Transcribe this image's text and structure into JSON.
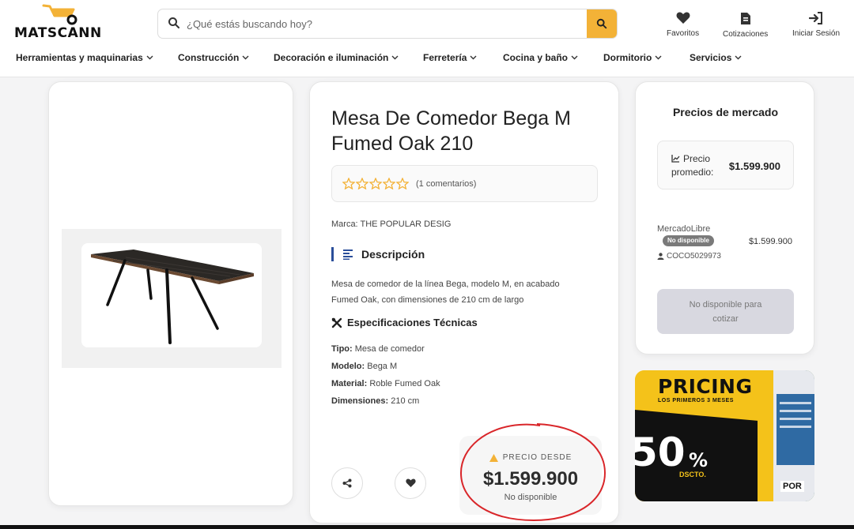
{
  "brand": {
    "name": "MATSCANN"
  },
  "search": {
    "placeholder": "¿Qué estás buscando hoy?"
  },
  "header_actions": [
    {
      "label": "Favoritos",
      "icon": "heart-icon"
    },
    {
      "label": "Cotizaciones",
      "icon": "document-icon"
    },
    {
      "label": "Iniciar Sesión",
      "icon": "login-icon"
    }
  ],
  "nav": [
    "Herramientas y maquinarias",
    "Construcción",
    "Decoración e iluminación",
    "Ferretería",
    "Cocina y baño",
    "Dormitorio",
    "Servicios"
  ],
  "product": {
    "title": "Mesa De Comedor Bega M Fumed Oak 210",
    "rating_stars": 0,
    "rating_max": 5,
    "comments": "(1 comentarios)",
    "brand_line": "Marca: THE POPULAR DESIG",
    "description_heading": "Descripción",
    "description": "Mesa de comedor de la línea Bega, modelo M, en acabado Fumed Oak, con dimensiones de 210 cm de largo",
    "specs_heading": "Especificaciones Técnicas",
    "specs": [
      {
        "label": "Tipo:",
        "value": "Mesa de comedor"
      },
      {
        "label": "Modelo:",
        "value": "Bega M"
      },
      {
        "label": "Material:",
        "value": "Roble Fumed Oak"
      },
      {
        "label": "Dimensiones:",
        "value": "210 cm"
      }
    ],
    "price_label": "PRECIO DESDE",
    "price": "$1.599.900",
    "price_status": "No disponible"
  },
  "market": {
    "title": "Precios de mercado",
    "avg_label_1": "Precio",
    "avg_label_2": "promedio:",
    "avg_value": "$1.599.900",
    "seller": {
      "name": "MercadoLibre",
      "badge": "No disponible",
      "price": "$1.599.900",
      "user": "COCO5029973"
    },
    "quote_button_1": "No disponible para",
    "quote_button_2": "cotizar"
  },
  "promo": {
    "title": "PRICING",
    "subtitle": "LOS PRIMEROS 3 MESES",
    "big": "50",
    "pct": "%",
    "dscto": "DSCTO.",
    "por": "POR"
  },
  "colors": {
    "accent": "#f3b237",
    "star": "#f3b237",
    "heading_bar": "#2a4e9a",
    "annotation_red": "#d9262a"
  }
}
